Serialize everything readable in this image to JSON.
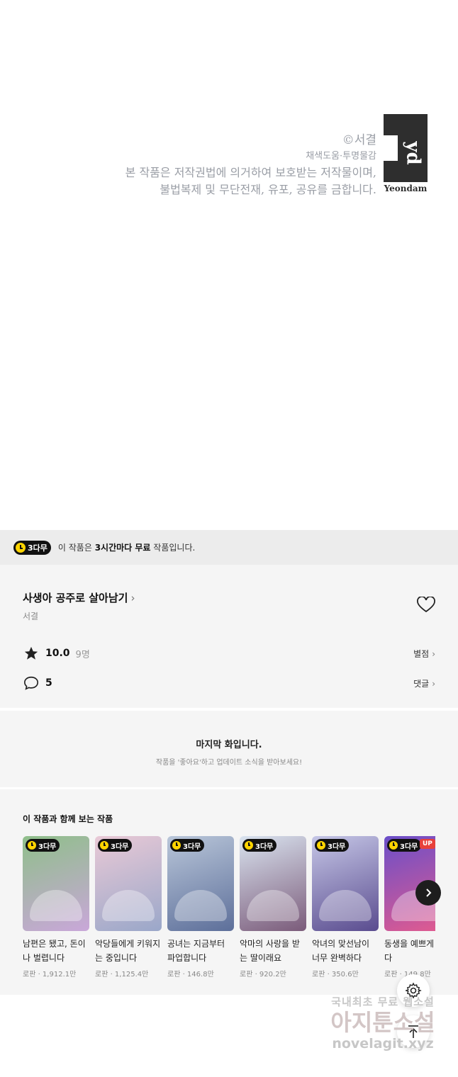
{
  "credits": {
    "copyright": "©서결",
    "coloring": "채색도움·투명물감",
    "legal_line1": "본 작품은 저작권법에 의거하여 보호받는 저작물이며,",
    "legal_line2": "불법복제 및 무단전재, 유포, 공유를 금합니다.",
    "logo_text": "Yeondam"
  },
  "free_notice": {
    "badge": "3다무",
    "text_prefix": "이 작품은 ",
    "text_bold": "3시간마다 무료",
    "text_suffix": " 작품입니다."
  },
  "work": {
    "title": "사생아 공주로 살아남기",
    "author": "서결",
    "rating": "10.0",
    "rating_count": "9명",
    "rating_link": "별점",
    "comment_count": "5",
    "comment_link": "댓글"
  },
  "last_episode": {
    "heading": "마지막 화입니다.",
    "subtext": "작품을 '좋아요'하고 업데이트 소식을 받아보세요!"
  },
  "recommendations": {
    "heading": "이 작품과 함께 보는 작품",
    "items": [
      {
        "badge": "3다무",
        "title": "남편은 됐고, 돈이나 벌렵니다",
        "meta": "로판 · 1,912.1만",
        "color1": "#8fbf8a",
        "color2": "#c9a7d9"
      },
      {
        "badge": "3다무",
        "title": "악당들에게 키워지는 중입니다",
        "meta": "로판 · 1,125.4만",
        "color1": "#e9c9d6",
        "color2": "#9aa7c9"
      },
      {
        "badge": "3다무",
        "title": "공녀는 지금부터 파업합니다",
        "meta": "로판 · 146.8만",
        "color1": "#b9c6d9",
        "color2": "#5d6f9a"
      },
      {
        "badge": "3다무",
        "title": "악마의 사랑을 받는 딸이래요",
        "meta": "로판 · 920.2만",
        "color1": "#d9e3ef",
        "color2": "#7b5b7a"
      },
      {
        "badge": "3다무",
        "title": "악녀의 맞선남이 너무 완벽하다",
        "meta": "로판 · 350.6만",
        "color1": "#c5c6e6",
        "color2": "#5a4c8f"
      },
      {
        "badge": "3다무",
        "up": "UP",
        "title": "동생을 예쁘게 웠다",
        "meta": "로판 · 149.8만",
        "color1": "#6a4fc9",
        "color2": "#e45b8e"
      }
    ]
  },
  "watermark": {
    "line1": "국내최초 무료 웹소설",
    "line2": "아지툰소설",
    "line3": "novelagit.xyz"
  },
  "icons": {
    "heart": "heart-outline-icon",
    "star": "star-icon",
    "comment": "comment-icon",
    "settings": "gear-icon",
    "top": "arrow-up-icon",
    "next": "chevron-right-icon"
  }
}
